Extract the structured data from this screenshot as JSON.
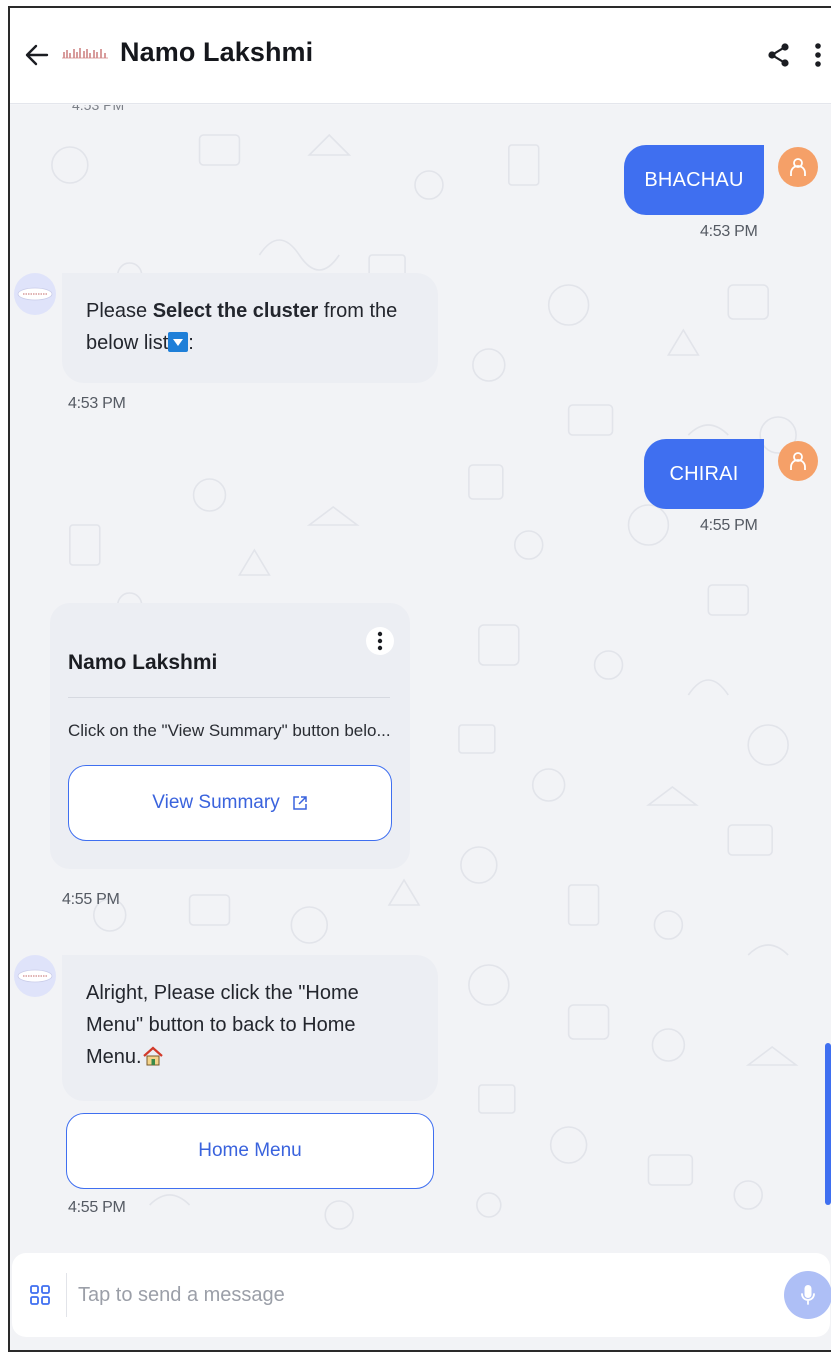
{
  "header": {
    "title": "Namo Lakshmi",
    "back_icon": "arrow-left-icon",
    "share_icon": "share-icon",
    "menu_icon": "more-vertical-icon"
  },
  "chat": {
    "messages": [
      {
        "type": "user",
        "text": "BHACHAU",
        "time": "4:53 PM"
      },
      {
        "type": "bot",
        "text_prefix": "Please ",
        "text_bold": "Select the cluster",
        "text_suffix": " from the below list",
        "text_end": ":",
        "time": "4:53 PM"
      },
      {
        "type": "user",
        "text": "CHIRAI",
        "time": "4:55 PM"
      },
      {
        "type": "card",
        "title": "Namo Lakshmi",
        "text": "Click on the \"View Summary\" button belo...",
        "button_label": "View Summary",
        "time": "4:55 PM"
      },
      {
        "type": "bot",
        "text": "Alright, Please click the \"Home Menu\" button to back to Home Menu.",
        "button_label": "Home Menu",
        "time": "4:55 PM"
      }
    ]
  },
  "composer": {
    "placeholder": "Tap to send a message",
    "apps_icon": "grid-icon",
    "mic_icon": "microphone-icon"
  },
  "colors": {
    "accent": "#3f6ff0",
    "user_avatar": "#f5a068",
    "bot_bubble": "#eceef3"
  }
}
